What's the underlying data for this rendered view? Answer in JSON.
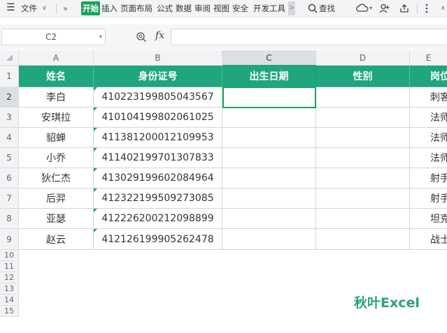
{
  "toolbar": {
    "menu_label": "文件",
    "more": "»",
    "tabs": [
      "开始",
      "插入",
      "页面布局",
      "公式",
      "数据",
      "审阅",
      "视图",
      "安全",
      "开发工具"
    ],
    "search_label": "查找",
    "overflow_marker": ">"
  },
  "formula_bar": {
    "cell_ref": "C2",
    "fx_label": "fx",
    "value": ""
  },
  "columns": [
    "A",
    "B",
    "C",
    "D",
    "E"
  ],
  "rows": [
    "1",
    "2",
    "3",
    "4",
    "5",
    "6",
    "7",
    "8",
    "9",
    "10",
    "11",
    "12",
    "13",
    "14",
    "15"
  ],
  "table": {
    "headers": [
      "姓名",
      "身份证号",
      "出生日期",
      "性别",
      "岗位"
    ],
    "records": [
      [
        "李白",
        "410223199805043567",
        "",
        "",
        "刺客"
      ],
      [
        "安琪拉",
        "410104199802061025",
        "",
        "",
        "法师"
      ],
      [
        "貂蝉",
        "411381200012109953",
        "",
        "",
        "法师"
      ],
      [
        "小乔",
        "411402199701307833",
        "",
        "",
        "法师"
      ],
      [
        "狄仁杰",
        "413029199602084964",
        "",
        "",
        "射手"
      ],
      [
        "后羿",
        "412322199509273085",
        "",
        "",
        "射手"
      ],
      [
        "亚瑟",
        "412226200212098899",
        "",
        "",
        "坦克"
      ],
      [
        "赵云",
        "412126199905262478",
        "",
        "",
        "战士"
      ]
    ]
  },
  "watermark": "秋叶Excel",
  "colors": {
    "header_fill": "#1fa67f",
    "accent": "#1aa45b",
    "selection": "#1aa45b"
  }
}
